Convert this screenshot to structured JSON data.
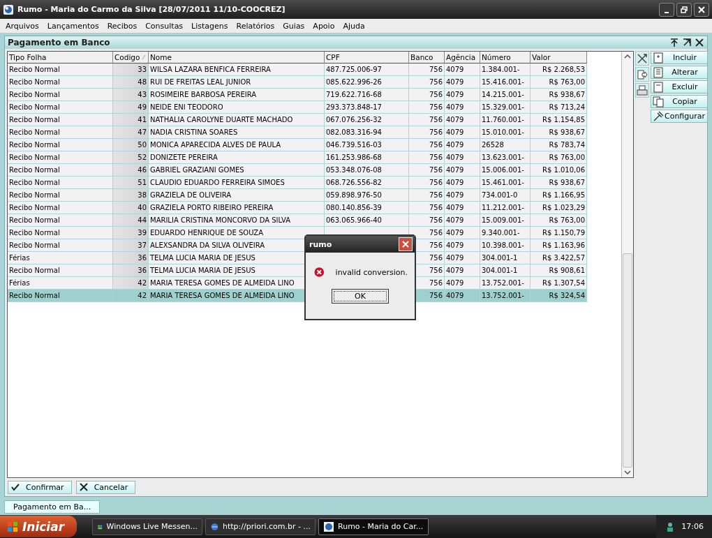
{
  "window": {
    "title": "Rumo - Maria do Carmo da Silva [28/07/2011 11/10-COOCREZ]"
  },
  "menu": [
    "Arquivos",
    "Lançamentos",
    "Recibos",
    "Consultas",
    "Listagens",
    "Relatórios",
    "Guias",
    "Apoio",
    "Ajuda"
  ],
  "panel": {
    "title": "Pagamento em Banco"
  },
  "table": {
    "columns": [
      "Tipo Folha",
      "Codigo",
      "Nome",
      "CPF",
      "Banco",
      "Agência",
      "Número",
      "Valor"
    ],
    "rows": [
      {
        "tipo": "Recibo Normal",
        "codigo": "33",
        "nome": "WILSA LAZARA BENFICA FERREIRA",
        "cpf": "487.725.006-97",
        "banco": "756",
        "agencia": "4079",
        "numero": "1.384.001-",
        "valor": "R$ 2.268,53",
        "selected": false
      },
      {
        "tipo": "Recibo Normal",
        "codigo": "48",
        "nome": "RUI DE FREITAS LEAL JUNIOR",
        "cpf": "085.622.996-26",
        "banco": "756",
        "agencia": "4079",
        "numero": "15.416.001-",
        "valor": "R$ 763,00",
        "selected": false
      },
      {
        "tipo": "Recibo Normal",
        "codigo": "43",
        "nome": "ROSIMEIRE BARBOSA PEREIRA",
        "cpf": "719.622.716-68",
        "banco": "756",
        "agencia": "4079",
        "numero": "14.215.001-",
        "valor": "R$ 938,67",
        "selected": false
      },
      {
        "tipo": "Recibo Normal",
        "codigo": "49",
        "nome": "NEIDE ENI TEODORO",
        "cpf": "293.373.848-17",
        "banco": "756",
        "agencia": "4079",
        "numero": "15.329.001-",
        "valor": "R$ 713,24",
        "selected": false
      },
      {
        "tipo": "Recibo Normal",
        "codigo": "41",
        "nome": "NATHALIA CAROLYNE DUARTE MACHADO",
        "cpf": "067.076.256-32",
        "banco": "756",
        "agencia": "4079",
        "numero": "11.760.001-",
        "valor": "R$ 1.154,85",
        "selected": false
      },
      {
        "tipo": "Recibo Normal",
        "codigo": "47",
        "nome": "NADIA CRISTINA SOARES",
        "cpf": "082.083.316-94",
        "banco": "756",
        "agencia": "4079",
        "numero": "15.010.001-",
        "valor": "R$ 938,67",
        "selected": false
      },
      {
        "tipo": "Recibo Normal",
        "codigo": "50",
        "nome": "MONICA APARECIDA ALVES DE PAULA",
        "cpf": "046.739.516-03",
        "banco": "756",
        "agencia": "4079",
        "numero": "26528",
        "valor": "R$ 783,74",
        "selected": false
      },
      {
        "tipo": "Recibo Normal",
        "codigo": "52",
        "nome": "DONIZETE PEREIRA",
        "cpf": "161.253.986-68",
        "banco": "756",
        "agencia": "4079",
        "numero": "13.623.001-",
        "valor": "R$ 763,00",
        "selected": false
      },
      {
        "tipo": "Recibo Normal",
        "codigo": "46",
        "nome": "GABRIEL GRAZIANI GOMES",
        "cpf": "053.348.076-08",
        "banco": "756",
        "agencia": "4079",
        "numero": "15.006.001-",
        "valor": "R$ 1.010,06",
        "selected": false
      },
      {
        "tipo": "Recibo Normal",
        "codigo": "51",
        "nome": "CLAUDIO EDUARDO FERREIRA SIMOES",
        "cpf": "068.726.556-82",
        "banco": "756",
        "agencia": "4079",
        "numero": "15.461.001-",
        "valor": "R$ 938,67",
        "selected": false
      },
      {
        "tipo": "Recibo Normal",
        "codigo": "38",
        "nome": "GRAZIELA DE OLIVEIRA",
        "cpf": "059.898.976-50",
        "banco": "756",
        "agencia": "4079",
        "numero": "734.001-0",
        "valor": "R$ 1.166,95",
        "selected": false
      },
      {
        "tipo": "Recibo Normal",
        "codigo": "40",
        "nome": "GRAZIELA PORTO RIBEIRO PEREIRA",
        "cpf": "080.140.856-39",
        "banco": "756",
        "agencia": "4079",
        "numero": "11.212.001-",
        "valor": "R$ 1.023,29",
        "selected": false
      },
      {
        "tipo": "Recibo Normal",
        "codigo": "44",
        "nome": "MARILIA CRISTINA MONCORVO DA SILVA",
        "cpf": "063.065.966-40",
        "banco": "756",
        "agencia": "4079",
        "numero": "15.009.001-",
        "valor": "R$ 763,00",
        "selected": false
      },
      {
        "tipo": "Recibo Normal",
        "codigo": "39",
        "nome": "EDUARDO HENRIQUE DE SOUZA",
        "banco": "756",
        "agencia": "4079",
        "numero": "9.340.001-",
        "valor": "R$ 1.150,79",
        "selected": false
      },
      {
        "tipo": "Recibo Normal",
        "codigo": "37",
        "nome": "ALEXSANDRA DA SILVA OLIVEIRA",
        "banco": "756",
        "agencia": "4079",
        "numero": "10.398.001-",
        "valor": "R$ 1.163,96",
        "selected": false
      },
      {
        "tipo": "Férias",
        "codigo": "36",
        "nome": "TELMA LUCIA MARIA DE JESUS",
        "banco": "756",
        "agencia": "4079",
        "numero": "304.001-1",
        "valor": "R$ 3.422,57",
        "selected": false
      },
      {
        "tipo": "Recibo Normal",
        "codigo": "36",
        "nome": "TELMA LUCIA MARIA DE JESUS",
        "banco": "756",
        "agencia": "4079",
        "numero": "304.001-1",
        "valor": "R$ 908,61",
        "selected": false
      },
      {
        "tipo": "Férias",
        "codigo": "42",
        "nome": "MARIA TERESA GOMES DE ALMEIDA LINO",
        "banco": "756",
        "agencia": "4079",
        "numero": "13.752.001-",
        "valor": "R$ 1.307,54",
        "selected": false
      },
      {
        "tipo": "Recibo Normal",
        "codigo": "42",
        "nome": "MARIA TERESA GOMES DE ALMEIDA LINO",
        "banco": "756",
        "agencia": "4079",
        "numero": "13.752.001-",
        "valor": "R$ 324,54",
        "selected": true
      }
    ]
  },
  "side_buttons": [
    {
      "label": "Incluir",
      "kind": "plus"
    },
    {
      "label": "Alterar",
      "kind": "edit"
    },
    {
      "label": "Excluir",
      "kind": "minus"
    },
    {
      "label": "Copiar",
      "kind": "copy"
    },
    {
      "label": "Configurar",
      "kind": "hammer"
    }
  ],
  "bottom_buttons": [
    {
      "label": "Confirmar",
      "kind": "check"
    },
    {
      "label": "Cancelar",
      "kind": "cross"
    }
  ],
  "document_tab": {
    "label": "Pagamento em Ba..."
  },
  "dialog": {
    "title": "rumo",
    "message": "invalid conversion.",
    "button": "OK"
  },
  "taskbar": {
    "start": "Iniciar",
    "items": [
      {
        "label": "Windows Live Messen...",
        "kind": "messenger",
        "selected": false
      },
      {
        "label": "http://priori.com.br - ...",
        "kind": "browser",
        "selected": false
      },
      {
        "label": "Rumo - Maria do Car...",
        "kind": "app",
        "selected": true
      }
    ],
    "clock": "17:06"
  }
}
